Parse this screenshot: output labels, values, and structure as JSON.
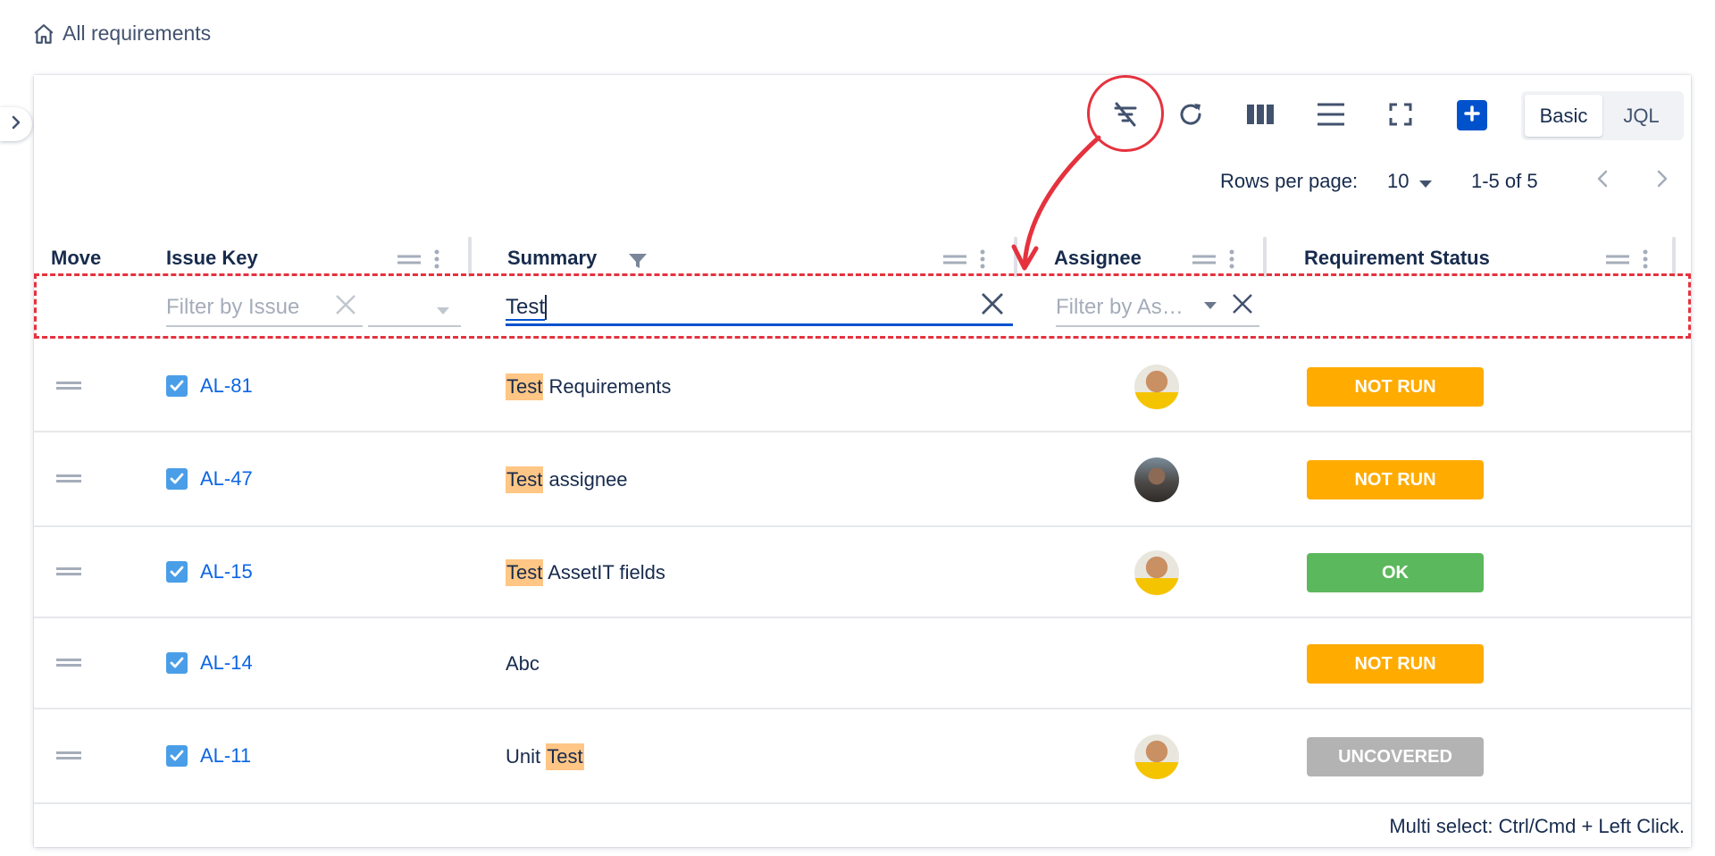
{
  "breadcrumb": {
    "label": "All requirements",
    "icon": "home-icon"
  },
  "toolbar": {
    "icons": [
      "clear-filter-icon",
      "refresh-icon",
      "columns-icon",
      "density-icon",
      "fullscreen-icon",
      "add-icon"
    ],
    "modes": [
      "Basic",
      "JQL"
    ],
    "active_mode": "Basic",
    "accent_color": "#0052cc"
  },
  "pagination": {
    "rows_per_page_label": "Rows per page:",
    "rows_per_page": "10",
    "range": "1-5 of 5"
  },
  "columns": {
    "move": "Move",
    "issue_key": "Issue Key",
    "summary": "Summary",
    "assignee": "Assignee",
    "status": "Requirement Status"
  },
  "filters": {
    "issue_placeholder": "Filter by Issue",
    "summary_value": "Test",
    "assignee_placeholder": "Filter by As…"
  },
  "rows": [
    {
      "key": "AL-81",
      "summary_highlight": "Test",
      "summary_rest": " Requirements",
      "highlight_first": true,
      "assignee": "avatar-a",
      "status": "NOT RUN",
      "status_color": "#ffab00"
    },
    {
      "key": "AL-47",
      "summary_highlight": "Test",
      "summary_rest": " assignee",
      "highlight_first": true,
      "assignee": "avatar-b",
      "status": "NOT RUN",
      "status_color": "#ffab00"
    },
    {
      "key": "AL-15",
      "summary_highlight": "Test",
      "summary_rest": " AssetIT fields",
      "highlight_first": true,
      "assignee": "avatar-a",
      "status": "OK",
      "status_color": "#5cb85c"
    },
    {
      "key": "AL-14",
      "summary_highlight": "",
      "summary_rest": "Abc",
      "highlight_first": true,
      "assignee": "",
      "status": "NOT RUN",
      "status_color": "#ffab00"
    },
    {
      "key": "AL-11",
      "summary_highlight": "Test",
      "summary_rest": "Unit ",
      "highlight_first": false,
      "assignee": "avatar-a",
      "status": "UNCOVERED",
      "status_color": "#b3b3b3"
    }
  ],
  "footer": {
    "note": "Multi select: Ctrl/Cmd + Left Click."
  },
  "annotation": {
    "color": "#e5323e"
  }
}
